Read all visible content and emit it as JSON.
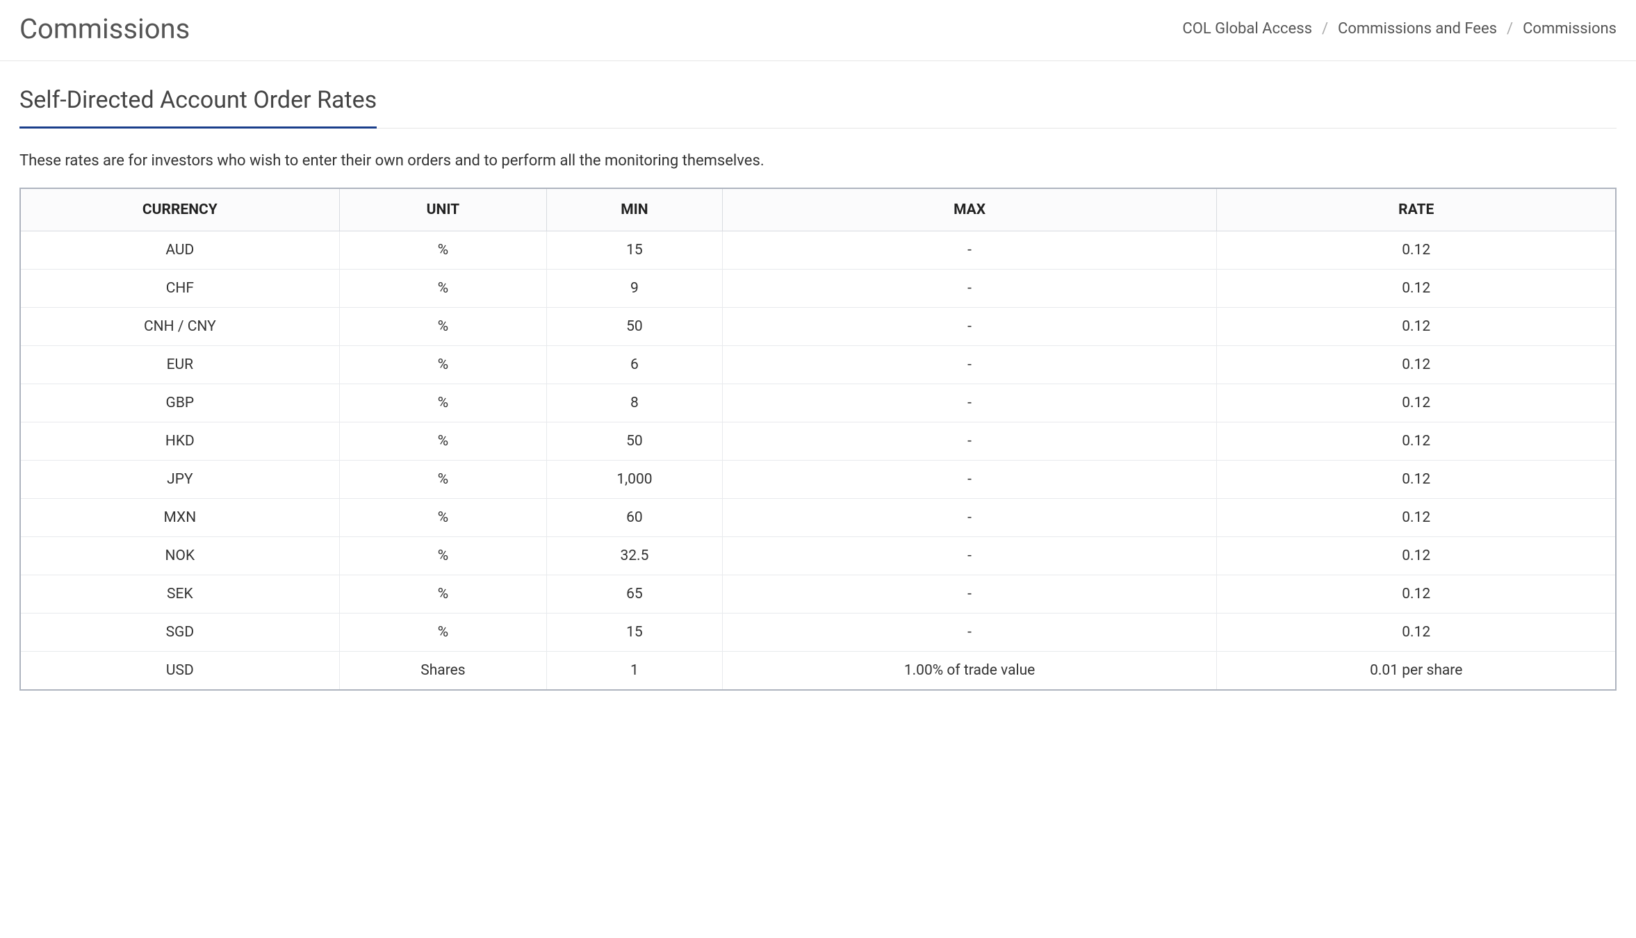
{
  "header": {
    "title": "Commissions",
    "breadcrumbs": {
      "level1": "COL Global Access",
      "level2": "Commissions and Fees",
      "level3": "Commissions"
    }
  },
  "section": {
    "title": "Self-Directed Account Order Rates",
    "description": "These rates are for investors who wish to enter their own orders and to perform all the monitoring themselves."
  },
  "table": {
    "headers": {
      "currency": "CURRENCY",
      "unit": "UNIT",
      "min": "MIN",
      "max": "MAX",
      "rate": "RATE"
    },
    "rows": [
      {
        "currency": "AUD",
        "unit": "%",
        "min": "15",
        "max": "-",
        "rate": "0.12"
      },
      {
        "currency": "CHF",
        "unit": "%",
        "min": "9",
        "max": "-",
        "rate": "0.12"
      },
      {
        "currency": "CNH / CNY",
        "unit": "%",
        "min": "50",
        "max": "-",
        "rate": "0.12"
      },
      {
        "currency": "EUR",
        "unit": "%",
        "min": "6",
        "max": "-",
        "rate": "0.12"
      },
      {
        "currency": "GBP",
        "unit": "%",
        "min": "8",
        "max": "-",
        "rate": "0.12"
      },
      {
        "currency": "HKD",
        "unit": "%",
        "min": "50",
        "max": "-",
        "rate": "0.12"
      },
      {
        "currency": "JPY",
        "unit": "%",
        "min": "1,000",
        "max": "-",
        "rate": "0.12"
      },
      {
        "currency": "MXN",
        "unit": "%",
        "min": "60",
        "max": "-",
        "rate": "0.12"
      },
      {
        "currency": "NOK",
        "unit": "%",
        "min": "32.5",
        "max": "-",
        "rate": "0.12"
      },
      {
        "currency": "SEK",
        "unit": "%",
        "min": "65",
        "max": "-",
        "rate": "0.12"
      },
      {
        "currency": "SGD",
        "unit": "%",
        "min": "15",
        "max": "-",
        "rate": "0.12"
      },
      {
        "currency": "USD",
        "unit": "Shares",
        "min": "1",
        "max": "1.00% of trade value",
        "rate": "0.01 per share"
      }
    ]
  }
}
